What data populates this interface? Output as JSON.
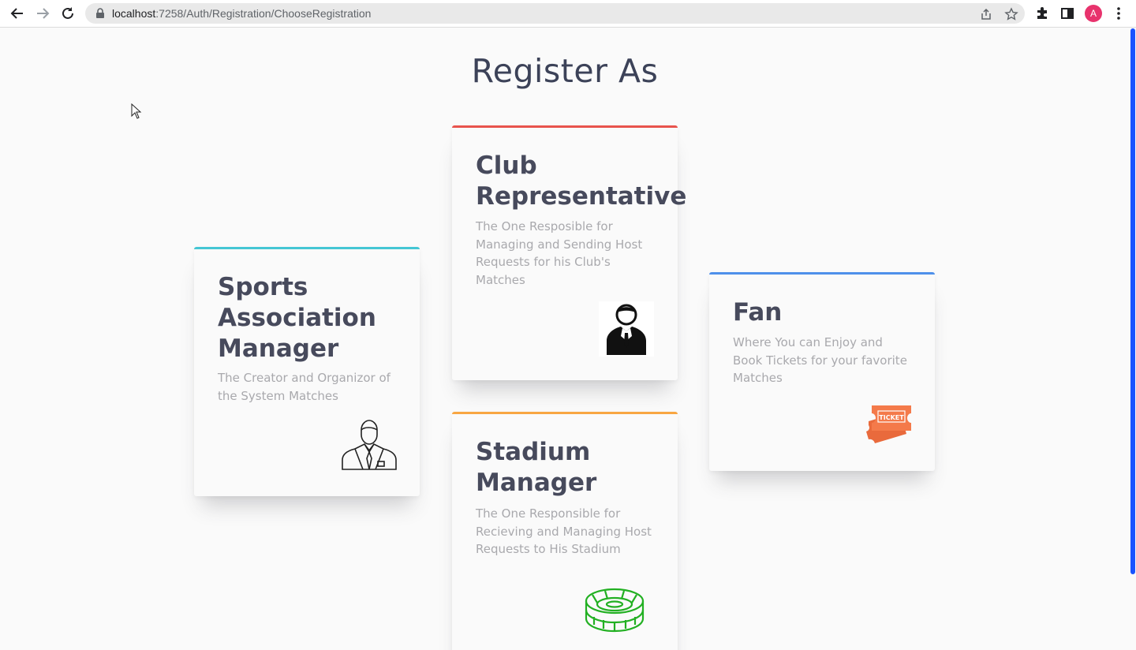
{
  "browser": {
    "url_host": "localhost",
    "url_rest": ":7258/Auth/Registration/ChooseRegistration",
    "profile_initial": "A"
  },
  "page": {
    "title": "Register As"
  },
  "cards": {
    "sports": {
      "title_lines": [
        "Sports",
        "Association",
        "Manager"
      ],
      "desc_lines": [
        "The Creator and Organizor of",
        "the System Matches"
      ],
      "icon": "businessman-outline-icon",
      "accent": "#44c6d4"
    },
    "club": {
      "title_lines": [
        "Club",
        "Representative"
      ],
      "desc_lines": [
        "The One Resposible for",
        "Managing and Sending Host",
        "Requests for his Club's",
        "Matches"
      ],
      "icon": "representative-silhouette-icon",
      "accent": "#e8534d"
    },
    "stadium": {
      "title_lines": [
        "Stadium",
        "Manager"
      ],
      "desc_lines": [
        "The One Responsible for",
        "Recieving and Managing Host",
        "Requests to His Stadium"
      ],
      "icon": "stadium-icon",
      "accent": "#f8a642"
    },
    "fan": {
      "title_lines": [
        "Fan"
      ],
      "desc_lines": [
        "Where You can Enjoy and",
        "Book Tickets for your favorite",
        "Matches"
      ],
      "icon": "ticket-icon",
      "ticket_label": "TICKET",
      "accent": "#4e90ea"
    }
  },
  "colors": {
    "title": "#3c4258",
    "card_title": "#474a5c",
    "card_desc": "#a9a9ad",
    "scroll_thumb": "#1a53ff"
  }
}
